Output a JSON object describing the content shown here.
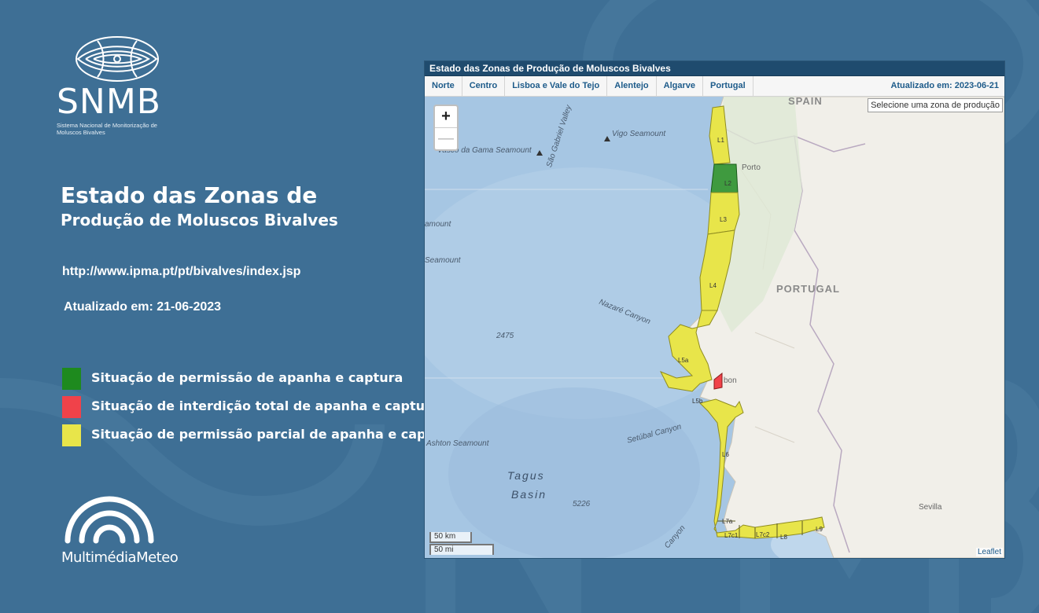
{
  "logo": {
    "abbr": "SNMB",
    "full_name": "Sistema Nacional de Monitorização de Moluscos Bivalves"
  },
  "title": {
    "line1": "Estado das Zonas de",
    "line2": "Produção de Moluscos Bivalves"
  },
  "url": "http://www.ipma.pt/pt/bivalves/index.jsp",
  "updated_left": "Atualizado em: 21-06-2023",
  "legend": [
    {
      "color": "#1e8a1e",
      "label": "Situação de permissão de apanha e captura"
    },
    {
      "color": "#f0424a",
      "label": "Situação de interdição total de apanha e captura"
    },
    {
      "color": "#e8e54a",
      "label": "Situação de permissão parcial de apanha e captura"
    }
  ],
  "footer_logo": "MultimédiaMeteo",
  "widget": {
    "title": "Estado das Zonas de Produção de Moluscos Bivalves",
    "tabs": [
      "Norte",
      "Centro",
      "Lisboa e Vale do Tejo",
      "Alentejo",
      "Algarve",
      "Portugal"
    ],
    "updated": "Atualizado em: 2023-06-21",
    "zone_select_placeholder": "Selecione uma zona de produção",
    "zoom_in": "+",
    "zoom_out": "—",
    "scale_km": "50 km",
    "scale_mi": "50 mi",
    "attribution": "Leaflet"
  },
  "map_labels": {
    "spain": "SPAIN",
    "portugal": "PORTUGAL",
    "porto": "Porto",
    "lisbon": "bon",
    "sevilla": "Sevilla",
    "vigo_seamount": "Vigo Seamount",
    "vasco_seamount": "Vasco da Gama Seamount",
    "sao_gabriel": "São Gabriel Valley",
    "seamount_left1": "amount",
    "seamount_left2": "Seamount",
    "nazare": "Nazaré Canyon",
    "depth_2475": "2475",
    "setubal": "Setúbal Canyon",
    "ashton": "Ashton Seamount",
    "tagus_line1": "Tagus",
    "tagus_line2": "Basin",
    "depth_5226": "5226",
    "canyon_s": "Canyon"
  },
  "zones": [
    {
      "id": "L1",
      "status": "parcial"
    },
    {
      "id": "L2",
      "status": "permissao"
    },
    {
      "id": "L3",
      "status": "parcial"
    },
    {
      "id": "L4",
      "status": "parcial"
    },
    {
      "id": "L5a",
      "status": "parcial"
    },
    {
      "id": "L5b",
      "status": "parcial"
    },
    {
      "id": "L6",
      "status": "parcial"
    },
    {
      "id": "L7a",
      "status": "parcial"
    },
    {
      "id": "L7c1",
      "status": "parcial"
    },
    {
      "id": "L7c2",
      "status": "parcial"
    },
    {
      "id": "L8",
      "status": "parcial"
    },
    {
      "id": "L9",
      "status": "parcial"
    },
    {
      "id": "Tejo",
      "status": "interdicao"
    }
  ],
  "zone_labels": {
    "L1": "L1",
    "L2": "L2",
    "L3": "L3",
    "L4": "L4",
    "L5a": "L5a",
    "L5b": "L5b",
    "L6": "L6",
    "L7a": "L7a",
    "L7c1": "L7c1",
    "L7c2": "L7c2",
    "L8": "L8",
    "L9": "L9"
  }
}
